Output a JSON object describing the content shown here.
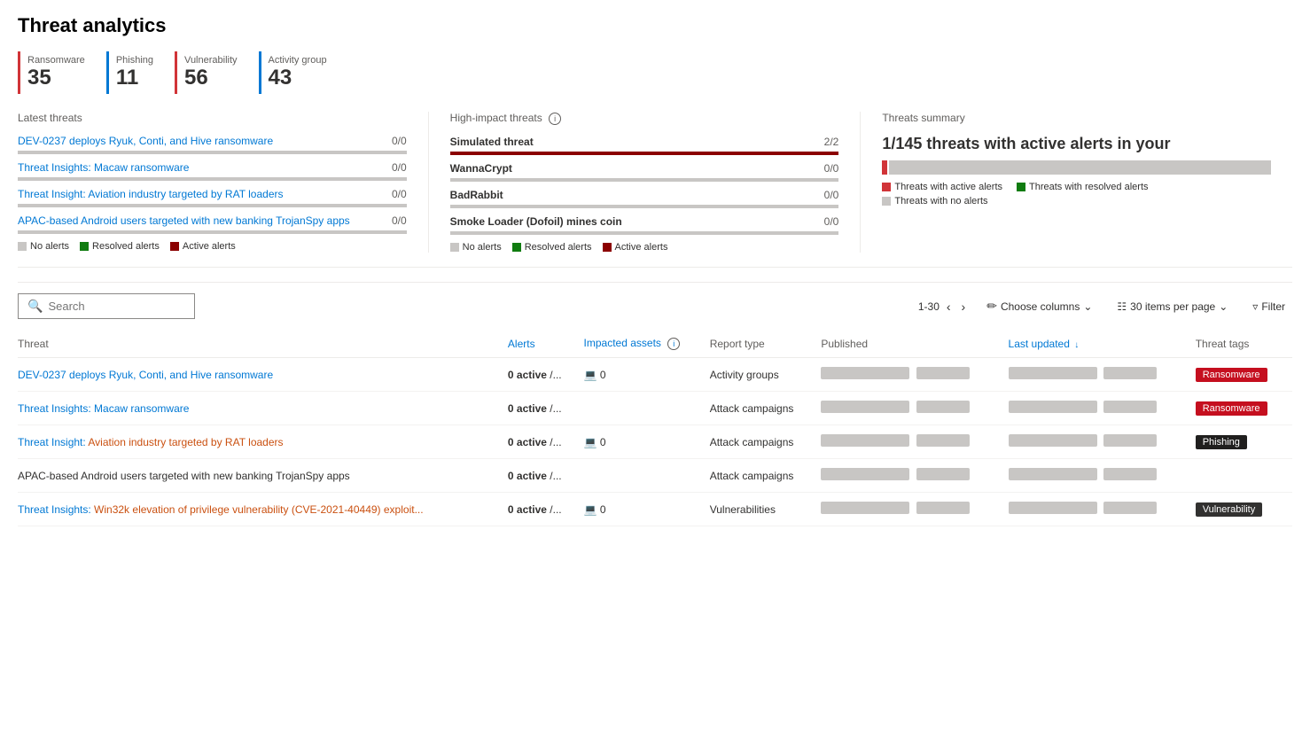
{
  "page": {
    "title": "Threat analytics"
  },
  "stats": [
    {
      "label": "Ransomware",
      "value": "35",
      "color": "#d13438"
    },
    {
      "label": "Phishing",
      "value": "11",
      "color": "#0078d4"
    },
    {
      "label": "Vulnerability",
      "value": "56",
      "color": "#d13438"
    },
    {
      "label": "Activity group",
      "value": "43",
      "color": "#0078d4"
    }
  ],
  "latest_threats": {
    "title": "Latest threats",
    "items": [
      {
        "name": "DEV-0237 deploys Ryuk, Conti, and Hive ransomware",
        "score": "0/0",
        "bar_width": "60",
        "bar_color": "gray"
      },
      {
        "name": "Threat Insights: Macaw ransomware",
        "score": "0/0",
        "bar_width": "55",
        "bar_color": "gray"
      },
      {
        "name": "Threat Insight: Aviation industry targeted by RAT loaders",
        "score": "0/0",
        "bar_width": "58",
        "bar_color": "gray"
      },
      {
        "name": "APAC-based Android users targeted with new banking TrojanSpy apps",
        "score": "0/0",
        "bar_width": "52",
        "bar_color": "gray"
      }
    ],
    "legend": [
      {
        "label": "No alerts",
        "color": "#c8c6c4"
      },
      {
        "label": "Resolved alerts",
        "color": "#107c10"
      },
      {
        "label": "Active alerts",
        "color": "#8b0000"
      }
    ]
  },
  "high_impact": {
    "title": "High-impact threats",
    "info": true,
    "items": [
      {
        "name": "Simulated threat",
        "score": "2/2",
        "bar_width": "100",
        "bar_color": "red"
      },
      {
        "name": "WannaCrypt",
        "score": "0/0",
        "bar_width": "55",
        "bar_color": "gray"
      },
      {
        "name": "BadRabbit",
        "score": "0/0",
        "bar_width": "50",
        "bar_color": "gray"
      },
      {
        "name": "Smoke Loader (Dofoil) mines coin",
        "score": "0/0",
        "bar_width": "45",
        "bar_color": "gray"
      }
    ],
    "legend": [
      {
        "label": "No alerts",
        "color": "#c8c6c4"
      },
      {
        "label": "Resolved alerts",
        "color": "#107c10"
      },
      {
        "label": "Active alerts",
        "color": "#8b0000"
      }
    ]
  },
  "summary": {
    "title": "Threats summary",
    "headline": "1/145 threats with active alerts in your",
    "legend": [
      {
        "label": "Threats with active alerts",
        "color": "#d13438"
      },
      {
        "label": "Threats with resolved alerts",
        "color": "#107c10"
      },
      {
        "label": "Threats with no alerts",
        "color": "#c8c6c4"
      }
    ]
  },
  "toolbar": {
    "search_placeholder": "Search",
    "pagination_label": "1-30",
    "choose_columns_label": "Choose columns",
    "items_per_page_label": "30 items per page",
    "filter_label": "Filter"
  },
  "table": {
    "columns": [
      {
        "key": "threat",
        "label": "Threat",
        "sortable": false
      },
      {
        "key": "alerts",
        "label": "Alerts",
        "sortable": false
      },
      {
        "key": "impacted",
        "label": "Impacted assets",
        "sortable": false,
        "info": true
      },
      {
        "key": "report_type",
        "label": "Report type",
        "sortable": false
      },
      {
        "key": "published",
        "label": "Published",
        "sortable": false
      },
      {
        "key": "last_updated",
        "label": "Last updated",
        "sortable": true
      },
      {
        "key": "tags",
        "label": "Threat tags",
        "sortable": false
      }
    ],
    "rows": [
      {
        "threat": "DEV-0237 deploys Ryuk, Conti, and Hive ransomware",
        "threat_link": true,
        "alerts": "0 active /...",
        "alerts_bold": true,
        "impacted": "0",
        "impacted_icon": true,
        "report_type": "Activity groups",
        "published_blurred": true,
        "updated_blurred": true,
        "tag": "Ransomware",
        "tag_color": "red"
      },
      {
        "threat": "Threat Insights: Macaw ransomware",
        "threat_link": true,
        "alerts": "0 active /...",
        "alerts_bold": true,
        "impacted": "",
        "impacted_icon": false,
        "report_type": "Attack campaigns",
        "published_blurred": true,
        "updated_blurred": true,
        "tag": "Ransomware",
        "tag_color": "red"
      },
      {
        "threat": "Threat Insight: Aviation industry targeted by RAT loaders",
        "threat_link": true,
        "threat_partial_orange": true,
        "alerts": "0 active /...",
        "alerts_bold": true,
        "impacted": "0",
        "impacted_icon": true,
        "report_type": "Attack campaigns",
        "published_blurred": true,
        "updated_blurred": true,
        "tag": "Phishing",
        "tag_color": "dark"
      },
      {
        "threat": "APAC-based Android users targeted with new banking TrojanSpy apps",
        "threat_link": false,
        "alerts": "0 active /...",
        "alerts_bold": true,
        "impacted": "",
        "impacted_icon": false,
        "report_type": "Attack campaigns",
        "published_blurred": true,
        "updated_blurred": true,
        "tag": "",
        "tag_color": ""
      },
      {
        "threat": "Threat Insights: Win32k elevation of privilege vulnerability (CVE-2021-40449) exploit...",
        "threat_link": true,
        "threat_partial_orange": true,
        "alerts": "0 active /...",
        "alerts_bold": true,
        "impacted": "0",
        "impacted_icon": true,
        "report_type": "Vulnerabilities",
        "published_blurred": true,
        "updated_blurred": true,
        "tag": "Vulnerability",
        "tag_color": "vulnerability"
      }
    ]
  }
}
